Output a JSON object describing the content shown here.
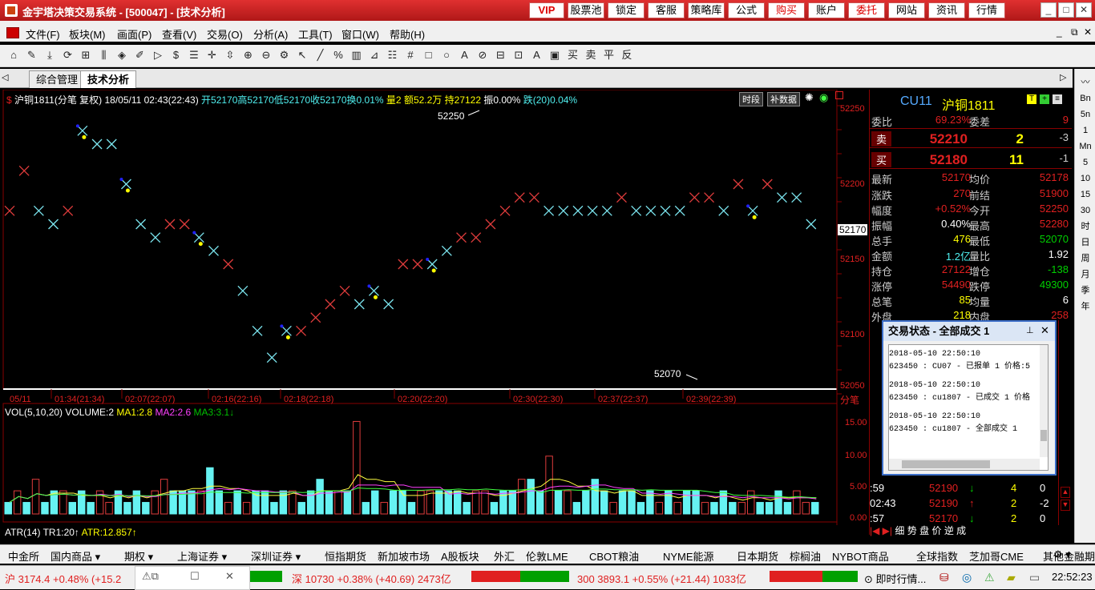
{
  "window": {
    "title": "金宇塔决策交易系统 - [500047] - [技术分析]",
    "top_buttons": [
      "VIP",
      "股票池",
      "锁定",
      "客服",
      "策略库",
      "公式",
      "购买",
      "账户",
      "委托",
      "网站",
      "资讯",
      "行情"
    ],
    "controls": [
      "_",
      "□",
      "✕"
    ]
  },
  "menu": [
    "文件(F)",
    "板块(M)",
    "画面(P)",
    "查看(V)",
    "交易(O)",
    "分析(A)",
    "工具(T)",
    "窗口(W)",
    "帮助(H)"
  ],
  "toolbar_symbols": [
    "⌂",
    "✎",
    "⤓",
    "⟳",
    "⊞",
    "⫼",
    "◈",
    "✐",
    "▷",
    "$",
    "☰",
    "✛",
    "⇳",
    "⊕",
    "⊖",
    "⚙",
    "↖",
    "╱",
    "%",
    "▥",
    "⊿",
    "☷",
    "#",
    "□",
    "○",
    "A",
    "⊘",
    "⊟",
    "⊡",
    "A",
    "▣",
    "买",
    "卖",
    "平",
    "反"
  ],
  "tabs": {
    "tab1": "综合管理",
    "tab2": "技术分析"
  },
  "chart": {
    "header": "沪铜1811(分笔 复权) 18/05/11 02:43(22:43)",
    "open": "开52170",
    "high": "高52170",
    "low": "低52170",
    "close": "收52170",
    "change": "换0.01%",
    "volume": "量2",
    "amount": "额52.2万",
    "hold": "持27122",
    "amp": "振0.00%",
    "fall": "跌(20)0.04%",
    "btn_time": "时段",
    "btn_fill": "补数据",
    "high_label": "52250",
    "low_label": "52070",
    "current_price_tag": "52170",
    "price_ticks": [
      "52250",
      "52200",
      "52150",
      "52100",
      "52050"
    ],
    "time_labels": [
      "05/11",
      "01:34(21:34)",
      "02:07(22:07)",
      "02:16(22:16)",
      "02:18(22:18)",
      "02:20(22:20)",
      "02:30(22:30)",
      "02:37(22:37)",
      "02:39(22:39)"
    ],
    "fenbi_label": "分笔",
    "vol_header": "VOL(5,10,20) VOLUME:2",
    "ma1": "MA1:2.8",
    "ma2": "MA2:2.6",
    "ma3": "MA3:3.1↓",
    "vol_ticks": [
      "15.00",
      "10.00",
      "5.00",
      "0.00"
    ],
    "atr": "ATR(14)",
    "tr1": "TR1:20↑",
    "atr_val": "ATR:12.857↑"
  },
  "chart_data": {
    "type": "scatter",
    "points": [
      [
        0,
        52180,
        "r"
      ],
      [
        1,
        52210,
        "r"
      ],
      [
        2,
        52180,
        "c"
      ],
      [
        3,
        52170,
        "c"
      ],
      [
        4,
        52180,
        "r"
      ],
      [
        5,
        52240,
        "y"
      ],
      [
        6,
        52230,
        "c"
      ],
      [
        7,
        52230,
        "c"
      ],
      [
        8,
        52200,
        "y"
      ],
      [
        9,
        52170,
        "c"
      ],
      [
        10,
        52160,
        "c"
      ],
      [
        11,
        52170,
        "r"
      ],
      [
        12,
        52170,
        "r"
      ],
      [
        13,
        52160,
        "y"
      ],
      [
        14,
        52150,
        "c"
      ],
      [
        15,
        52140,
        "r"
      ],
      [
        16,
        52120,
        "c"
      ],
      [
        17,
        52090,
        "c"
      ],
      [
        18,
        52070,
        "c"
      ],
      [
        19,
        52090,
        "y"
      ],
      [
        20,
        52090,
        "r"
      ],
      [
        21,
        52100,
        "r"
      ],
      [
        22,
        52110,
        "r"
      ],
      [
        23,
        52120,
        "r"
      ],
      [
        24,
        52110,
        "c"
      ],
      [
        25,
        52120,
        "y"
      ],
      [
        26,
        52110,
        "c"
      ],
      [
        27,
        52140,
        "r"
      ],
      [
        28,
        52140,
        "r"
      ],
      [
        29,
        52140,
        "y"
      ],
      [
        30,
        52150,
        "c"
      ],
      [
        31,
        52160,
        "r"
      ],
      [
        32,
        52160,
        "r"
      ],
      [
        33,
        52170,
        "r"
      ],
      [
        34,
        52180,
        "r"
      ],
      [
        35,
        52190,
        "r"
      ],
      [
        36,
        52190,
        "r"
      ],
      [
        37,
        52180,
        "c"
      ],
      [
        38,
        52180,
        "c"
      ],
      [
        39,
        52180,
        "c"
      ],
      [
        40,
        52180,
        "c"
      ],
      [
        41,
        52180,
        "c"
      ],
      [
        42,
        52190,
        "r"
      ],
      [
        43,
        52180,
        "c"
      ],
      [
        44,
        52180,
        "c"
      ],
      [
        45,
        52180,
        "c"
      ],
      [
        46,
        52180,
        "c"
      ],
      [
        47,
        52190,
        "r"
      ],
      [
        48,
        52190,
        "r"
      ],
      [
        49,
        52180,
        "c"
      ],
      [
        50,
        52200,
        "r"
      ],
      [
        51,
        52180,
        "y"
      ],
      [
        52,
        52200,
        "r"
      ],
      [
        53,
        52190,
        "c"
      ],
      [
        54,
        52190,
        "c"
      ],
      [
        55,
        52170,
        "c"
      ]
    ],
    "volumes": [
      2,
      4,
      2,
      6,
      2,
      4,
      4,
      2,
      4,
      2,
      4,
      2,
      4,
      2,
      4,
      2,
      4,
      6,
      4,
      4,
      4,
      4,
      8,
      4,
      2,
      4,
      2,
      4,
      4,
      2,
      4,
      4,
      2,
      4,
      6,
      4,
      4,
      4,
      16,
      2,
      4,
      2,
      4,
      4,
      2,
      4,
      4,
      4,
      4,
      4,
      2,
      4,
      4,
      2,
      4,
      4,
      6,
      6,
      4,
      10,
      4,
      4,
      2,
      4,
      6,
      4,
      2,
      4,
      4,
      2,
      4,
      2,
      4,
      2,
      4,
      4,
      2,
      2,
      4,
      2,
      2,
      4,
      2,
      2,
      4,
      2,
      4,
      2,
      2
    ],
    "ylim": [
      52050,
      52260
    ],
    "vol_ylim": [
      0,
      18
    ]
  },
  "quote": {
    "code": "CU11",
    "name": "沪铜1811",
    "rows": [
      {
        "l": "委比",
        "v": "69.23%",
        "l2": "委差",
        "v2": "9"
      },
      {
        "l": "卖",
        "v": "52210",
        "l2": "",
        "v2": "2",
        "v3": "-3"
      },
      {
        "l": "买",
        "v": "52180",
        "l2": "",
        "v2": "11",
        "v3": "-1"
      },
      {
        "l": "最新",
        "v": "52170",
        "l2": "均价",
        "v2": "52178"
      },
      {
        "l": "涨跌",
        "v": "270",
        "l2": "前结",
        "v2": "51900"
      },
      {
        "l": "幅度",
        "v": "+0.52%",
        "l2": "今开",
        "v2": "52250"
      },
      {
        "l": "振幅",
        "v": "0.40%",
        "l2": "最高",
        "v2": "52280"
      },
      {
        "l": "总手",
        "v": "476",
        "l2": "最低",
        "v2": "52070"
      },
      {
        "l": "金额",
        "v": "1.2亿",
        "l2": "量比",
        "v2": "1.92"
      },
      {
        "l": "持仓",
        "v": "27122",
        "l2": "增仓",
        "v2": "-138"
      },
      {
        "l": "涨停",
        "v": "54490",
        "l2": "跌停",
        "v2": "49300"
      },
      {
        "l": "总笔",
        "v": "85",
        "l2": "均量",
        "v2": "6"
      },
      {
        "l": "外盘",
        "v": "218",
        "l2": "内盘",
        "v2": "258"
      }
    ],
    "ticks": [
      {
        "t": ":59",
        "p": "52190",
        "d": "↓",
        "v": "4",
        "c": "0"
      },
      {
        "t": "02:43",
        "p": "52190",
        "d": "↑",
        "v": "2",
        "c": "-2"
      },
      {
        "t": ":57",
        "p": "52170",
        "d": "↓",
        "v": "2",
        "c": "0"
      }
    ],
    "bottom_tabs": [
      "细",
      "势",
      "盘",
      "价",
      "逆",
      "成"
    ]
  },
  "popup": {
    "title": "交易状态 - 全部成交 1",
    "lines": [
      "2018-05-10 22:50:10",
      "623450 : CU07 - 已报单 1 价格:5",
      "2018-05-10 22:50:10",
      "623450 : cu1807 - 已成交 1 价格",
      "2018-05-10 22:50:10",
      "623450 : cu1807 - 全部成交 1"
    ]
  },
  "sidebar": [
    "Bn",
    "5n",
    "1",
    "Mn",
    "5",
    "10",
    "15",
    "30",
    "时",
    "日",
    "周",
    "月",
    "季",
    "年"
  ],
  "market_tabs": [
    "中金所",
    "国内商品 ▾",
    "期权 ▾",
    "上海证券 ▾",
    "深圳证券 ▾",
    "恒指期货",
    "新加坡市场",
    "A股板块",
    "外汇",
    "伦敦LME",
    "CBOT粮油",
    "NYME能源",
    "日本期货",
    "棕榈油",
    "NYBOT商品",
    "全球指数",
    "芝加哥CME",
    "其他金融期货 ▾"
  ],
  "status": {
    "sh": "沪 3174.4 +0.48% (+15.2",
    "sz": "深 10730 +0.38% (+40.69) 2473亿",
    "hs300": "300 3893.1 +0.55% (+21.44) 1033亿",
    "realtime": "即时行情...",
    "time": "22:52:23"
  }
}
